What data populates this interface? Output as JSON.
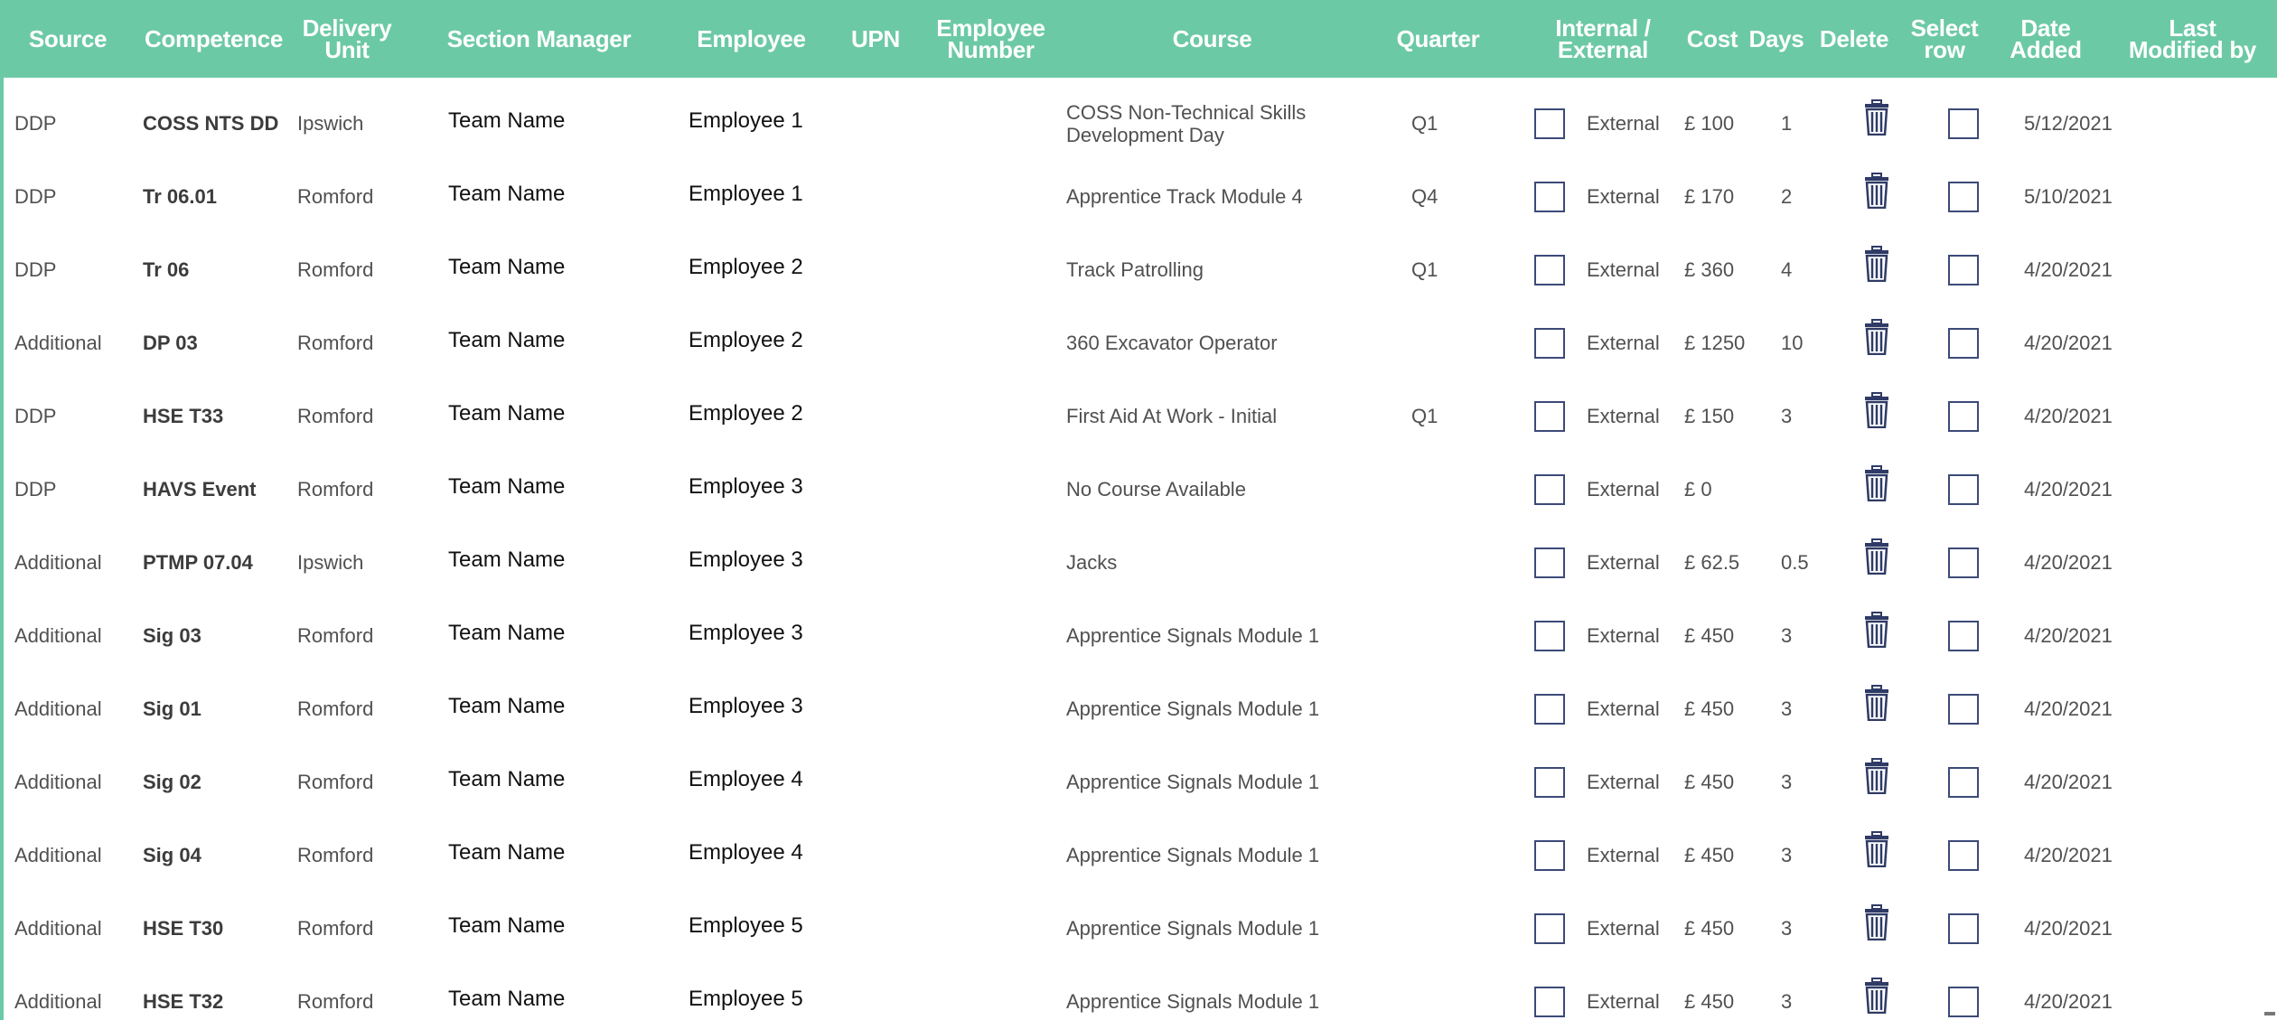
{
  "columns": [
    {
      "key": "source",
      "label": "Source"
    },
    {
      "key": "competence",
      "label": "Competence"
    },
    {
      "key": "delivery_unit",
      "label": "Delivery\nUnit"
    },
    {
      "key": "section_manager",
      "label": "Section Manager"
    },
    {
      "key": "employee",
      "label": "Employee"
    },
    {
      "key": "upn",
      "label": "UPN"
    },
    {
      "key": "employee_number",
      "label": "Employee\nNumber"
    },
    {
      "key": "course",
      "label": "Course"
    },
    {
      "key": "quarter",
      "label": "Quarter"
    },
    {
      "key": "internal_external",
      "label": "Internal /\nExternal"
    },
    {
      "key": "cost",
      "label": "Cost"
    },
    {
      "key": "days",
      "label": "Days"
    },
    {
      "key": "delete",
      "label": "Delete"
    },
    {
      "key": "select_row",
      "label": "Select\nrow"
    },
    {
      "key": "date_added",
      "label": "Date\nAdded"
    },
    {
      "key": "last_modified_by",
      "label": "Last\nModified by"
    }
  ],
  "icons": {
    "checkbox": "checkbox-icon",
    "delete": "trash-icon"
  },
  "colors": {
    "header_bg": "#6cc9a6",
    "header_text": "#ffffff",
    "checkbox_border": "#3c4a78",
    "trash": "#2f3b66"
  },
  "rows": [
    {
      "source": "DDP",
      "competence": "COSS NTS DD",
      "delivery_unit": "Ipswich",
      "section_manager": "Team Name",
      "employee": "Employee 1",
      "course": "COSS Non-Technical Skills Development Day",
      "quarter": "Q1",
      "internal_external": "External",
      "cost": "£ 100",
      "days": "1",
      "date_added": "5/12/2021"
    },
    {
      "source": "DDP",
      "competence": "Tr 06.01",
      "delivery_unit": "Romford",
      "section_manager": "Team Name",
      "employee": "Employee 1",
      "course": "Apprentice Track Module 4",
      "quarter": "Q4",
      "internal_external": "External",
      "cost": "£ 170",
      "days": "2",
      "date_added": "5/10/2021"
    },
    {
      "source": "DDP",
      "competence": "Tr 06",
      "delivery_unit": "Romford",
      "section_manager": "Team Name",
      "employee": "Employee 2",
      "course": "Track Patrolling",
      "quarter": "Q1",
      "internal_external": "External",
      "cost": "£ 360",
      "days": "4",
      "date_added": "4/20/2021"
    },
    {
      "source": "Additional",
      "competence": "DP 03",
      "delivery_unit": "Romford",
      "section_manager": "Team Name",
      "employee": "Employee 2",
      "course": "360 Excavator Operator",
      "quarter": "",
      "internal_external": "External",
      "cost": "£ 1250",
      "days": "10",
      "date_added": "4/20/2021"
    },
    {
      "source": "DDP",
      "competence": "HSE T33",
      "delivery_unit": "Romford",
      "section_manager": "Team Name",
      "employee": "Employee 2",
      "course": "First Aid At Work - Initial",
      "quarter": "Q1",
      "internal_external": "External",
      "cost": "£ 150",
      "days": "3",
      "date_added": "4/20/2021"
    },
    {
      "source": "DDP",
      "competence": "HAVS Event",
      "delivery_unit": "Romford",
      "section_manager": "Team Name",
      "employee": "Employee 3",
      "course": "No Course Available",
      "quarter": "",
      "internal_external": "External",
      "cost": "£ 0",
      "days": "",
      "date_added": "4/20/2021"
    },
    {
      "source": "Additional",
      "competence": "PTMP 07.04",
      "delivery_unit": "Ipswich",
      "section_manager": "Team Name",
      "employee": "Employee 3",
      "course": "Jacks",
      "quarter": "",
      "internal_external": "External",
      "cost": "£ 62.5",
      "days": "0.5",
      "date_added": "4/20/2021"
    },
    {
      "source": "Additional",
      "competence": "Sig 03",
      "delivery_unit": "Romford",
      "section_manager": "Team Name",
      "employee": "Employee 3",
      "course": "Apprentice Signals Module 1",
      "quarter": "",
      "internal_external": "External",
      "cost": "£ 450",
      "days": "3",
      "date_added": "4/20/2021"
    },
    {
      "source": "Additional",
      "competence": "Sig 01",
      "delivery_unit": "Romford",
      "section_manager": "Team Name",
      "employee": "Employee 3",
      "course": "Apprentice Signals Module 1",
      "quarter": "",
      "internal_external": "External",
      "cost": "£ 450",
      "days": "3",
      "date_added": "4/20/2021"
    },
    {
      "source": "Additional",
      "competence": "Sig 02",
      "delivery_unit": "Romford",
      "section_manager": "Team Name",
      "employee": "Employee 4",
      "course": "Apprentice Signals Module 1",
      "quarter": "",
      "internal_external": "External",
      "cost": "£ 450",
      "days": "3",
      "date_added": "4/20/2021"
    },
    {
      "source": "Additional",
      "competence": "Sig 04",
      "delivery_unit": "Romford",
      "section_manager": "Team Name",
      "employee": "Employee 4",
      "course": "Apprentice Signals Module 1",
      "quarter": "",
      "internal_external": "External",
      "cost": "£ 450",
      "days": "3",
      "date_added": "4/20/2021"
    },
    {
      "source": "Additional",
      "competence": "HSE T30",
      "delivery_unit": "Romford",
      "section_manager": "Team Name",
      "employee": "Employee 5",
      "course": "Apprentice Signals Module 1",
      "quarter": "",
      "internal_external": "External",
      "cost": "£ 450",
      "days": "3",
      "date_added": "4/20/2021"
    },
    {
      "source": "Additional",
      "competence": "HSE T32",
      "delivery_unit": "Romford",
      "section_manager": "Team Name",
      "employee": "Employee 5",
      "course": "Apprentice Signals Module 1",
      "quarter": "",
      "internal_external": "External",
      "cost": "£ 450",
      "days": "3",
      "date_added": "4/20/2021"
    }
  ]
}
